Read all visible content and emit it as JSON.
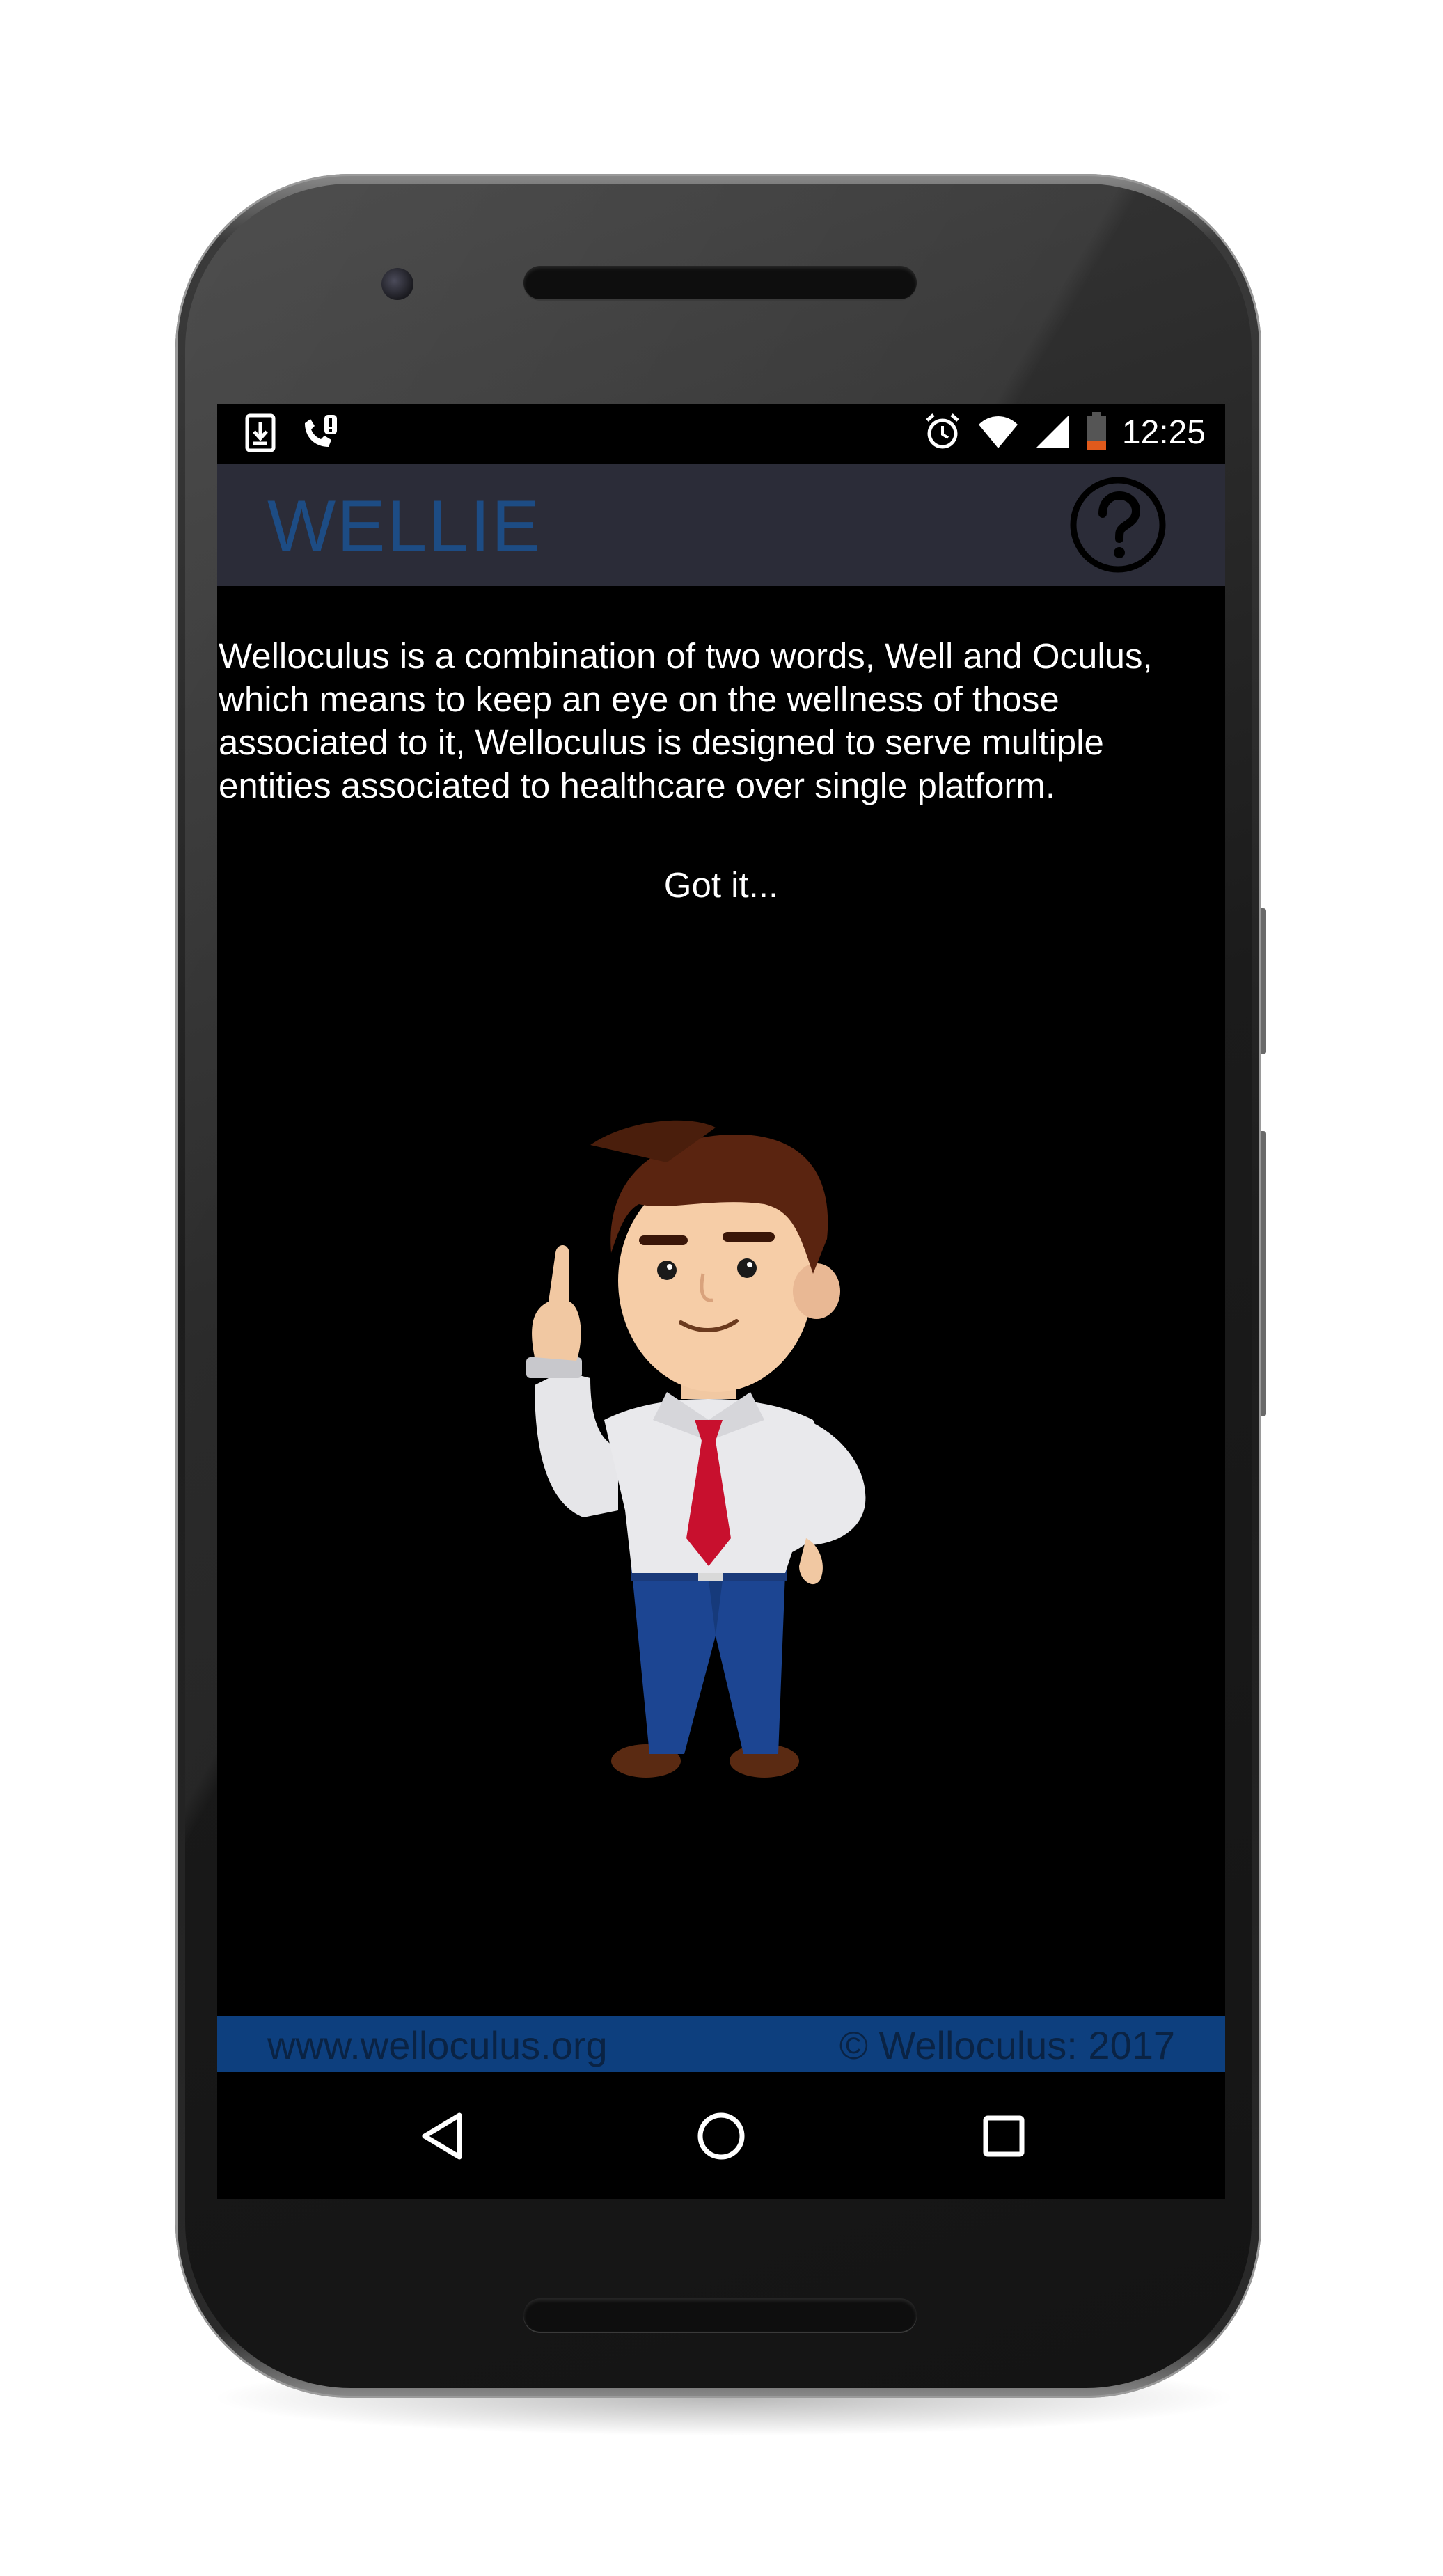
{
  "status_bar": {
    "time": "12:25",
    "left_icons": [
      "download-icon",
      "phone-alert-icon"
    ],
    "right_icons": [
      "alarm-icon",
      "wifi-icon",
      "signal-icon",
      "battery-low-icon"
    ]
  },
  "app_bar": {
    "title": "WELLIE",
    "help_icon": "help-icon"
  },
  "content": {
    "intro": "Welloculus is a combination of two words, Well and Oculus, which means to keep an eye on the wellness of those associated to it, Welloculus is designed to serve multiple entities associated to healthcare over single platform.",
    "got_it": "Got it..."
  },
  "footer": {
    "website": "www.welloculus.org",
    "copyright": "© Welloculus: 2017"
  },
  "nav_bar": {
    "back_icon": "back-triangle-icon",
    "home_icon": "home-circle-icon",
    "recents_icon": "recents-square-icon"
  },
  "colors": {
    "app_bar_bg": "#2b2c38",
    "title": "#1d4c84",
    "footer_bg": "#0d3f7e",
    "footer_text": "#0a2344",
    "screen_bg": "#000000"
  }
}
